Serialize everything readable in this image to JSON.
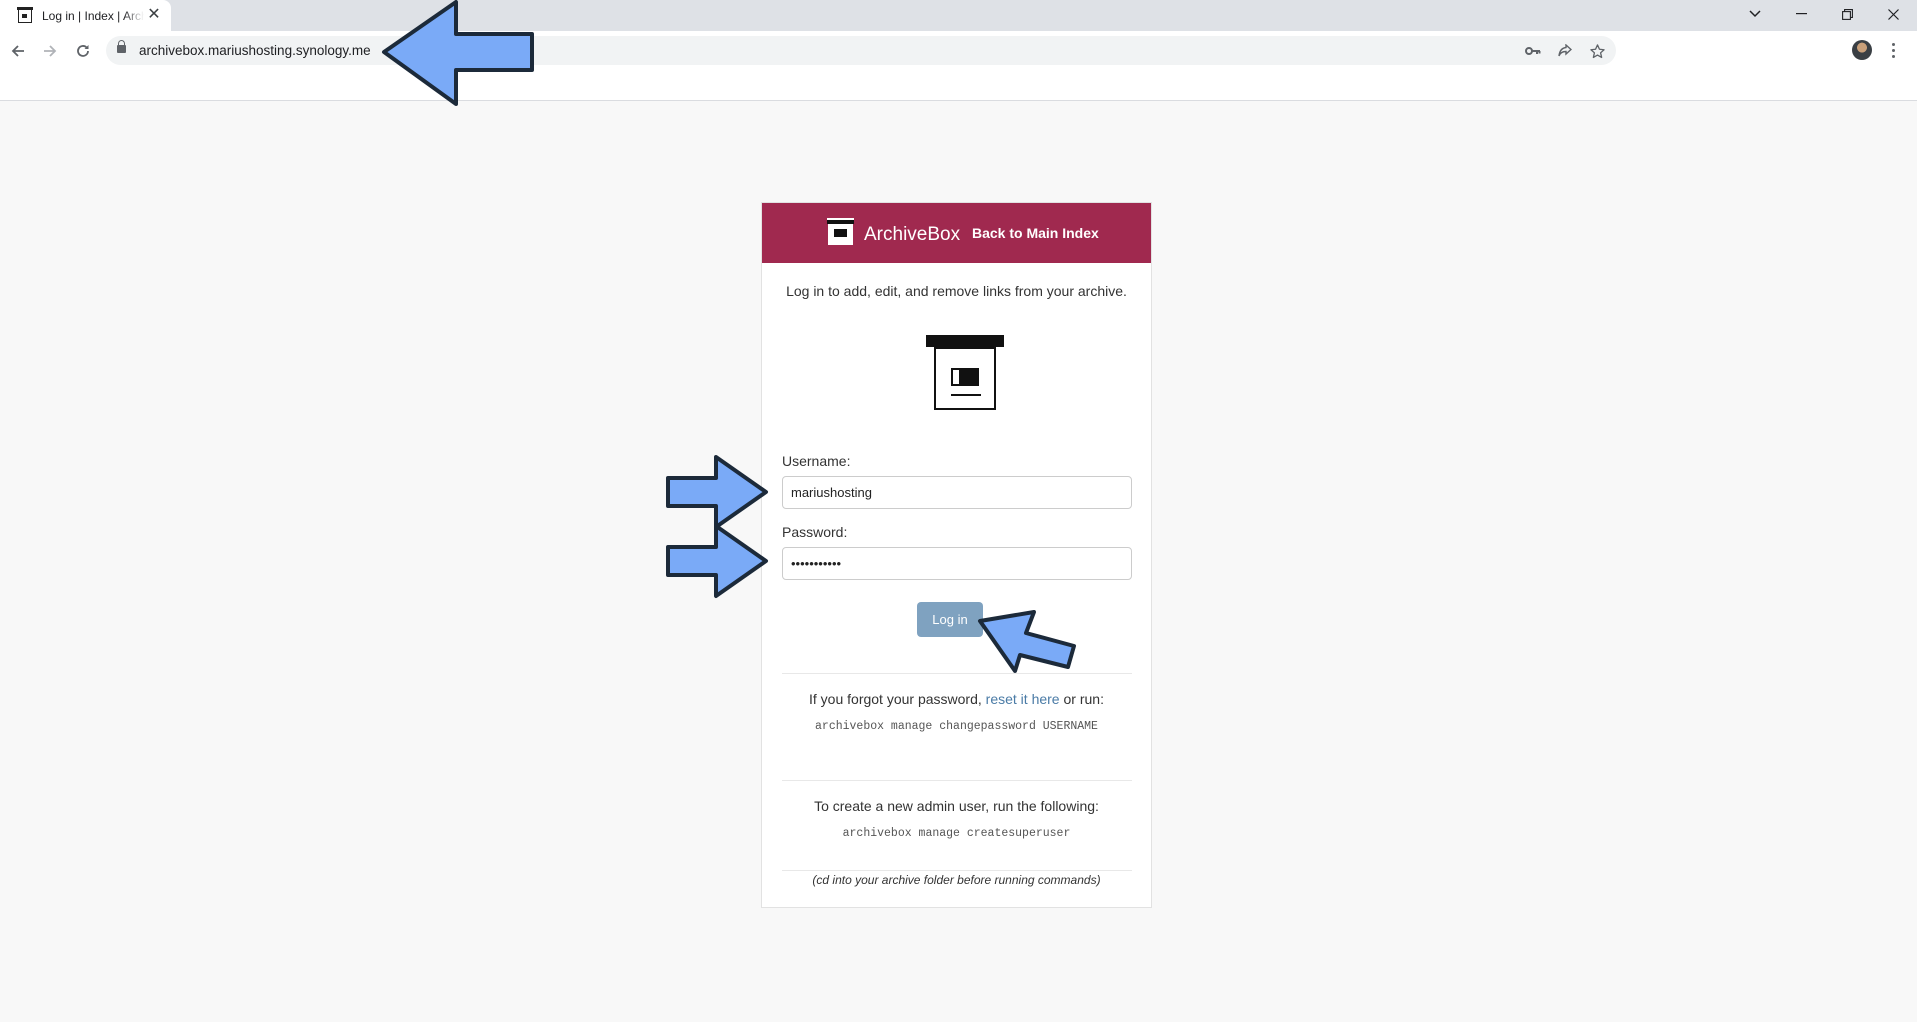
{
  "browser": {
    "tab_title": "Log in | Index | ArchiveBox",
    "url": "archivebox.mariushosting.synology.me"
  },
  "header": {
    "brand": "ArchiveBox",
    "back_link": "Back to Main Index",
    "brand_color": "#a0294f"
  },
  "login": {
    "intro": "Log in to add, edit, and remove links from your archive.",
    "username_label": "Username:",
    "username_value": "mariushosting",
    "password_label": "Password:",
    "password_value": "•••••••••••",
    "submit_label": "Log in"
  },
  "help": {
    "forgot_prefix": "If you forgot your password,",
    "reset_link": "reset it here",
    "forgot_suffix": "or run:",
    "change_cmd": "archivebox manage changepassword USERNAME",
    "create_text": "To create a new admin user, run the following:",
    "create_cmd": "archivebox manage createsuperuser",
    "note": "(cd into your archive folder before running commands)"
  },
  "annotation_color": "#7aaaf7"
}
